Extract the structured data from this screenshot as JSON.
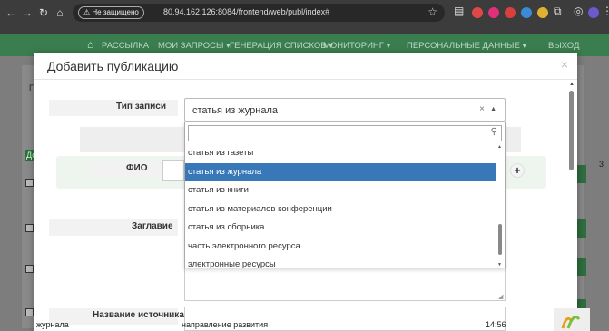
{
  "browser": {
    "security_label": "Не защищено",
    "url": "80.94.162.126:8084/frontend/web/publ/index#"
  },
  "appnav": {
    "items": [
      "РАССЫЛКА",
      "МОИ ЗАПРОСЫ ▾",
      "ГЕНЕРАЦИЯ СПИСКОВ ▾",
      "МОНИТОРИНГ ▾",
      "ПЕРСОНАЛЬНЫЕ ДАННЫЕ ▾",
      "ВЫХОД"
    ]
  },
  "background": {
    "row_values": [
      "3"
    ],
    "tab_fragment": "Гı",
    "btn_fragment": "Доб",
    "bottom_left": "журнала",
    "bottom_mid": "направление развития",
    "bottom_right": "14:56"
  },
  "modal": {
    "title": "Добавить публикацию",
    "close": "×",
    "labels": {
      "record_type": "Тип записи",
      "author": "ФИО",
      "title_field": "Заглавие",
      "source_name": "Название источника"
    },
    "select": {
      "value": "статья из журнала",
      "clear": "×",
      "arrow": "▲"
    },
    "dropdown": {
      "search_value": "",
      "options": [
        "статья из газеты",
        "статья из журнала",
        "статья из книги",
        "статья из материалов конференции",
        "статья из сборника",
        "часть электронного ресурса",
        "электронные ресурсы"
      ],
      "selected_index": 1
    },
    "add_author": "+"
  }
}
